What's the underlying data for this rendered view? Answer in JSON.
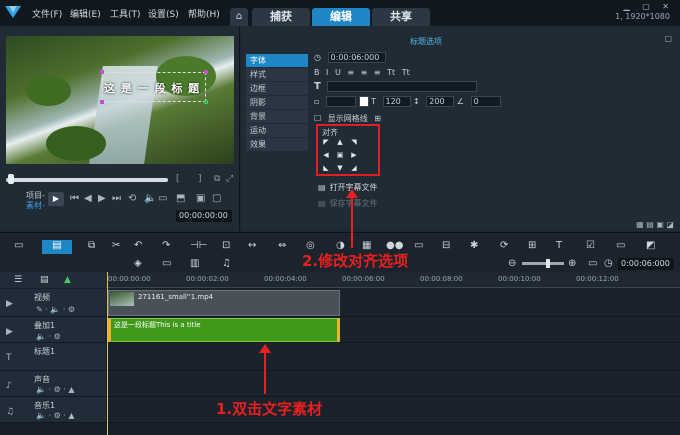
{
  "menu": [
    "文件(F)",
    "编辑(E)",
    "工具(T)",
    "设置(S)",
    "帮助(H)"
  ],
  "tabs": {
    "home": "⌂",
    "capture": "捕获",
    "edit": "编辑",
    "share": "共享"
  },
  "resolution": "1, 1920*1080",
  "preview": {
    "title_text": "这 是 一 段 标 题",
    "project_label": "项目-",
    "clip_label": "素材-",
    "timecode": "00:00:00:00"
  },
  "options": {
    "title": "标题选项",
    "sidebar": [
      "字体",
      "样式",
      "边框",
      "阴影",
      "背景",
      "运动",
      "效果"
    ],
    "duration": "0:00:06:000",
    "font_size": "120",
    "line_spacing": "200",
    "rotation": "0",
    "show_grid_label": "显示网格线",
    "align_label": "对齐",
    "open_title_file": "打开字幕文件",
    "save_title_file": "保存字幕文件"
  },
  "toolbar": {
    "total_timecode": "0:00:06:000"
  },
  "timeline": {
    "ticks": [
      "00:00:00:00",
      "00:00:02:00",
      "00:00:04:00",
      "00:00:06:00",
      "00:00:08:00",
      "00:00:10:00",
      "00:00:12:00"
    ],
    "tracks": [
      "视频",
      "叠加1",
      "标题1",
      "声音",
      "音乐1"
    ],
    "video_clip": "271161_small''1.mp4",
    "title_clip": "这是一段标题This is a title"
  },
  "annotations": {
    "step1": "1.双击文字素材",
    "step2": "2.修改对齐选项"
  },
  "colors": {
    "accent": "#1e88c6",
    "annotation": "#e82020",
    "title_clip": "#3f9a1c"
  }
}
